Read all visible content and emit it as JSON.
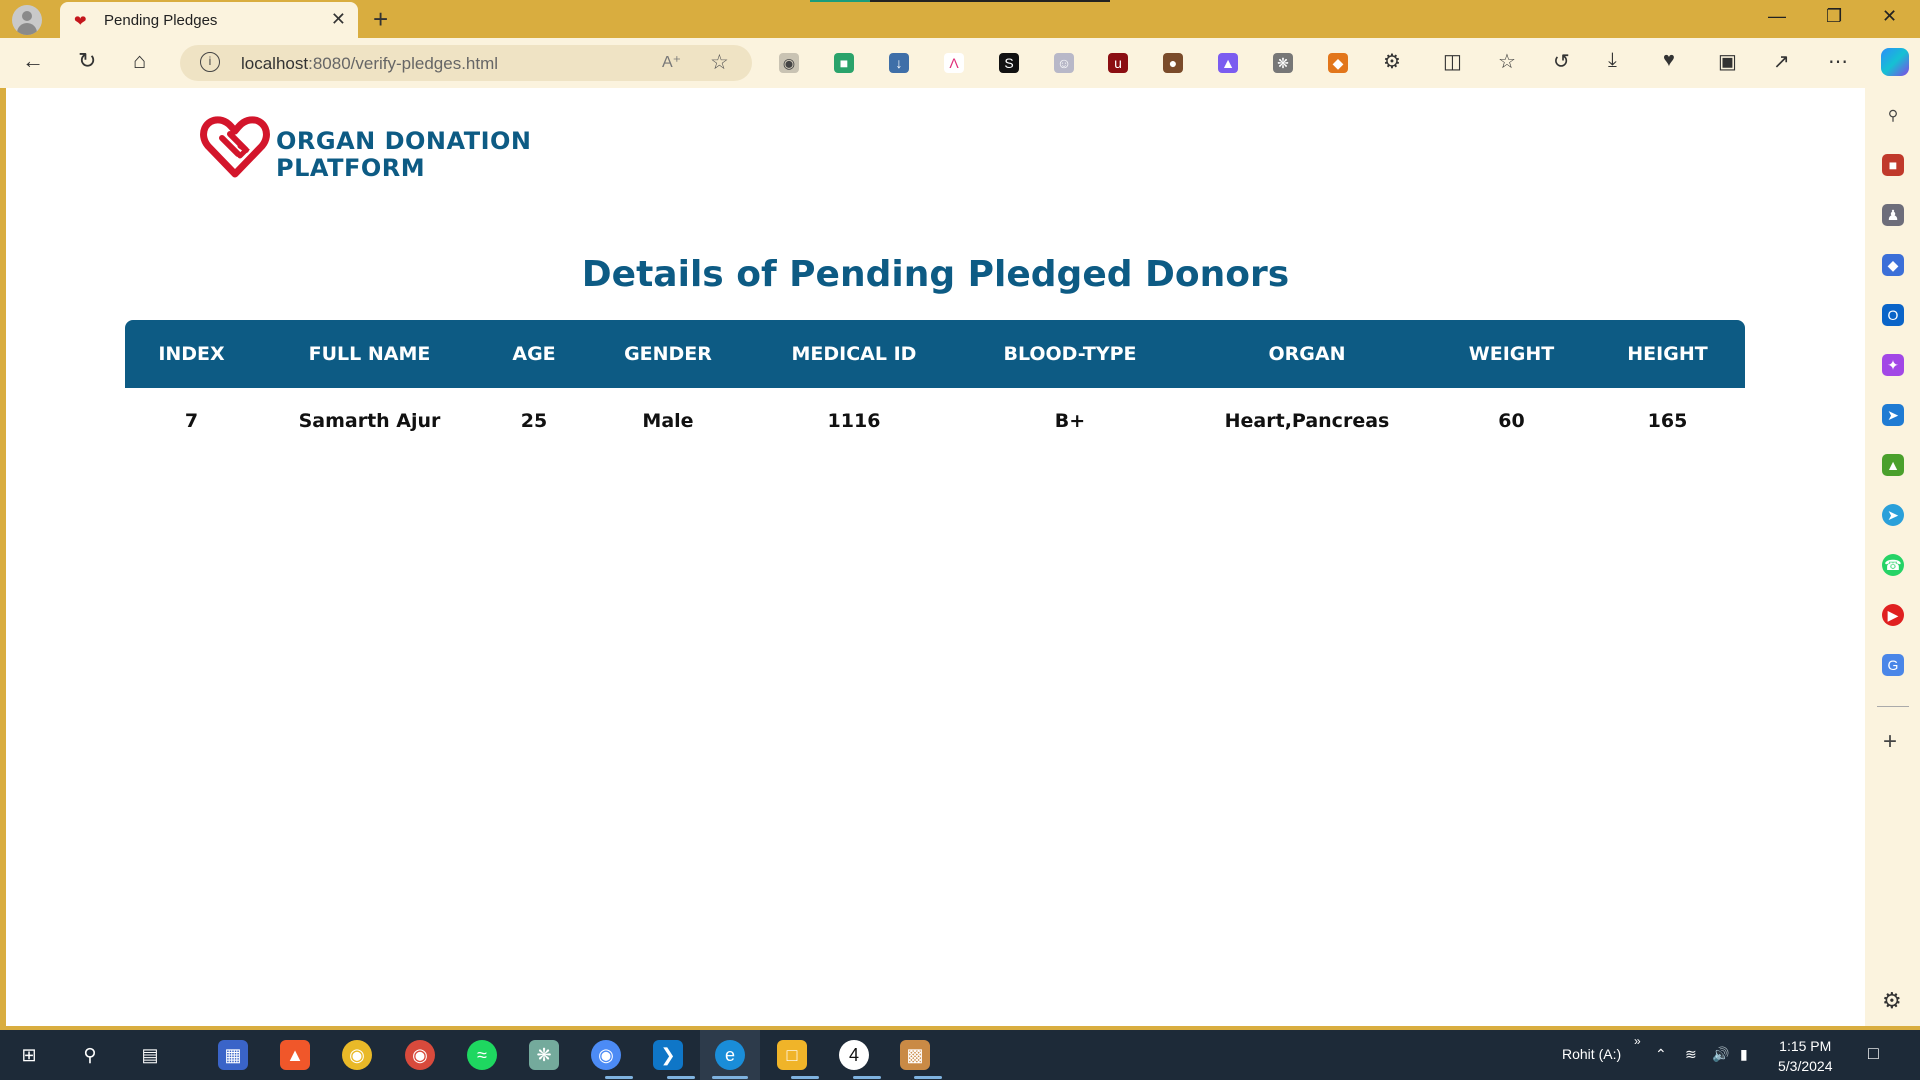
{
  "browser": {
    "tab_title": "Pending Pledges",
    "tab_favicon": "heart-icon",
    "url_host": "localhost",
    "url_rest": ":8080/verify-pledges.html",
    "read_aloud_label": "A̅̅"
  },
  "page": {
    "logo": {
      "line1": "ORGAN DONATION",
      "line2": "PLATFORM"
    },
    "heading": "Details of Pending Pledged Donors",
    "table": {
      "headers": [
        "INDEX",
        "FULL NAME",
        "AGE",
        "GENDER",
        "MEDICAL ID",
        "BLOOD-TYPE",
        "ORGAN",
        "WEIGHT",
        "HEIGHT"
      ],
      "rows": [
        [
          "7",
          "Samarth Ajur",
          "25",
          "Male",
          "1116",
          "B+",
          "Heart,Pancreas",
          "60",
          "165"
        ]
      ]
    }
  },
  "taskbar": {
    "user_label": "Rohit (A:)",
    "time": "1:15 PM",
    "date": "5/3/2024",
    "whatsapp_badge": "4"
  },
  "colors": {
    "brand_blue": "#0d5b84",
    "logo_red": "#d3152b",
    "chrome_gold": "#d9ad3f"
  }
}
